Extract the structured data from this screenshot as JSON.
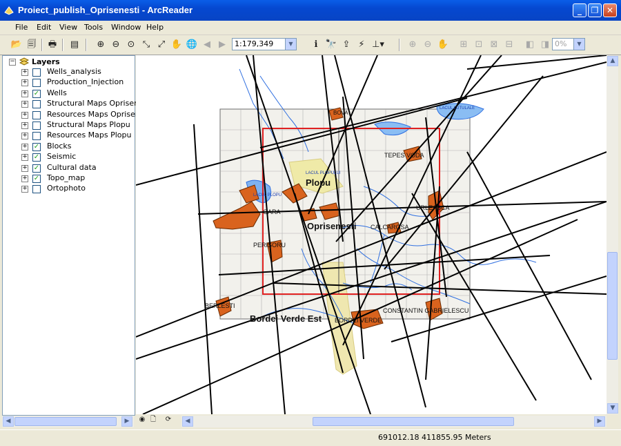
{
  "window": {
    "title": "Proiect_publish_Oprisenesti - ArcReader"
  },
  "menu": {
    "items": [
      "File",
      "Edit",
      "View",
      "Tools",
      "Window",
      "Help"
    ]
  },
  "toolbar": {
    "scale_value": "1:179,349",
    "zoom_value": "0%"
  },
  "toc": {
    "root_label": "Layers",
    "layers": [
      {
        "label": "Wells_analysis",
        "checked": false
      },
      {
        "label": "Production_Injection",
        "checked": false
      },
      {
        "label": "Wells",
        "checked": true
      },
      {
        "label": "Structural Maps Oprisenesti",
        "checked": false
      },
      {
        "label": "Resources Maps Oprisenest",
        "checked": false
      },
      {
        "label": "Structural Maps Plopu",
        "checked": false
      },
      {
        "label": "Resources Maps Plopu",
        "checked": false
      },
      {
        "label": "Blocks",
        "checked": true
      },
      {
        "label": "Seismic",
        "checked": true
      },
      {
        "label": "Cultural data",
        "checked": true
      },
      {
        "label": "Topo_map",
        "checked": true
      },
      {
        "label": "Ortophoto",
        "checked": false
      }
    ]
  },
  "map": {
    "labels": {
      "plopu": "Plopu",
      "oprisenesti": "Oprisenesti",
      "bordei_verde_est": "Bordei Verde Est",
      "bordei_verde": "BORDEI VERDE",
      "berlesti": "BERLESTI",
      "constantin": "CONSTANTIN GABRIELESCU",
      "urleasca": "URLEASCA",
      "perisoru": "PERISORU",
      "gara": "GARA",
      "tepes": "TEPES VODA",
      "bova": "BOVA",
      "lacul_lutulale": "LACUL LUTULALE",
      "lacul_plopului": "LACUL PLOPULUI",
      "lacul_plopu": "LACUL PLOPU",
      "calcarusa": "CALCAROSA"
    },
    "colors": {
      "block_boundary": "#E02020",
      "seismic": "#000000",
      "rivers": "#2F6FE0",
      "villages": "#E06A1A"
    }
  },
  "status": {
    "coords": "691012.18  411855.95 Meters"
  }
}
